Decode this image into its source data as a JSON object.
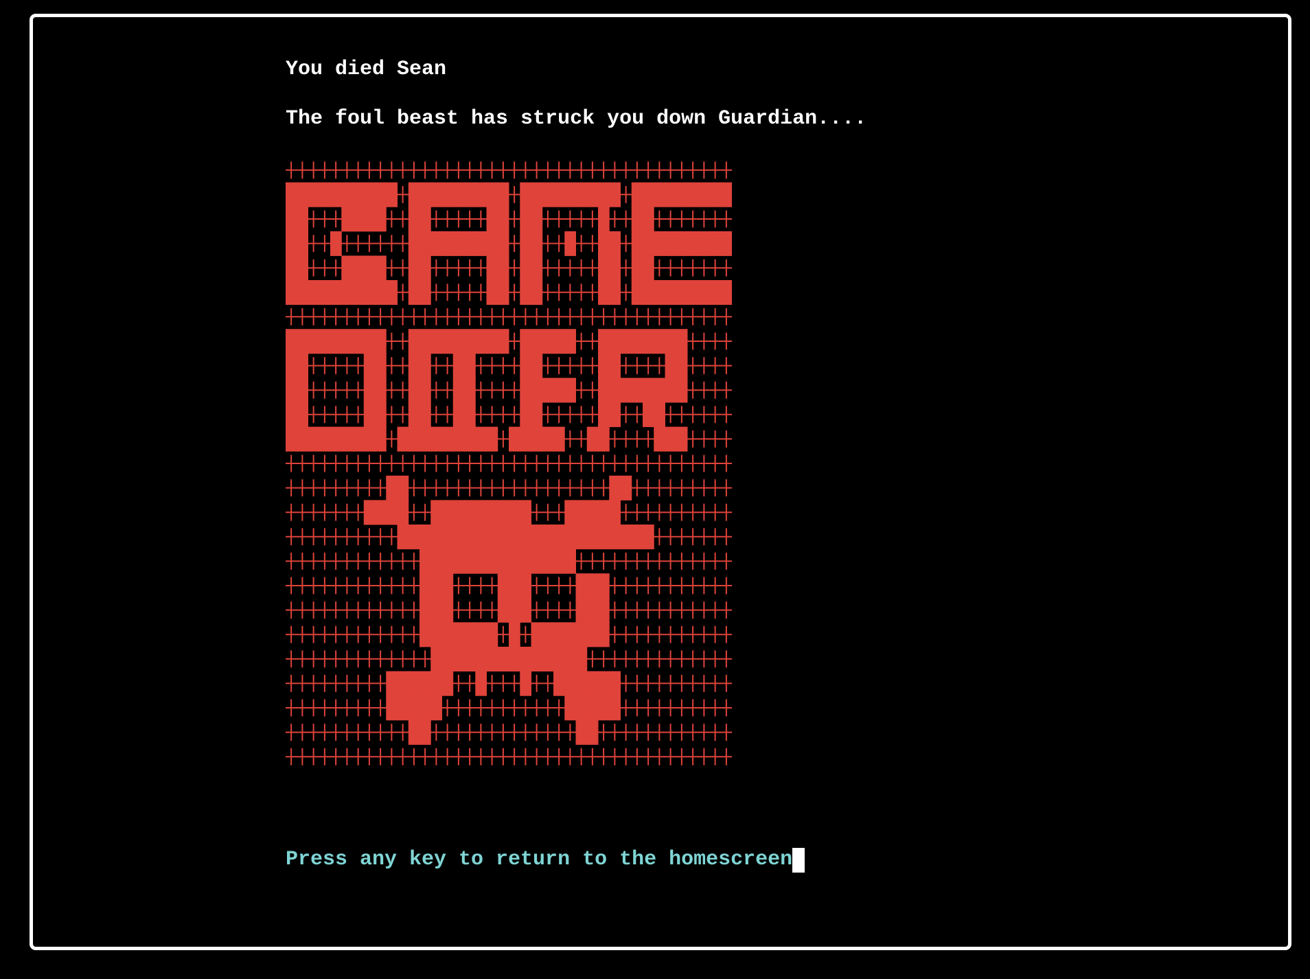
{
  "terminal": {
    "line_1": "You died Sean",
    "line_2": "The foul beast has struck you down Guardian....",
    "prompt": "Press any key to return to the homescreen"
  },
  "ascii_art": {
    "description_name": "game-over-skull-banner",
    "color_fill": "#e0433a",
    "color_grid": "#e0433a",
    "background": "#000000",
    "rows": [
      "........................................",
      "##########.#########.#########.#########",
      "##...####..##.....##.##.....#..##.......",
      "##..#......#########.##..#..##.#########",
      "##...####..##.....##.##.....##.##.......",
      "##########.##.....##.##.....##.#########",
      "........................................",
      "#########..#########.#####..########.....",
      "##.....##..##..##....##.....##....##.....",
      "##.....##..##..##....#####..########.....",
      "##.....##..##..##....##.....##..##.......",
      "#########.#########.#####..##....###.....",
      "........................................",
      ".........##..................##.........",
      ".......####..#########...#####.........",
      "..........#######################.......",
      "............##############..............",
      "............###....###....###...........",
      "............###....###....###...........",
      "............#######.#.#######...........",
      ".............##############.............",
      ".........######..#...#..######..........",
      ".........#####...........#####..........",
      "...........##.............##............",
      "........................................"
    ]
  }
}
